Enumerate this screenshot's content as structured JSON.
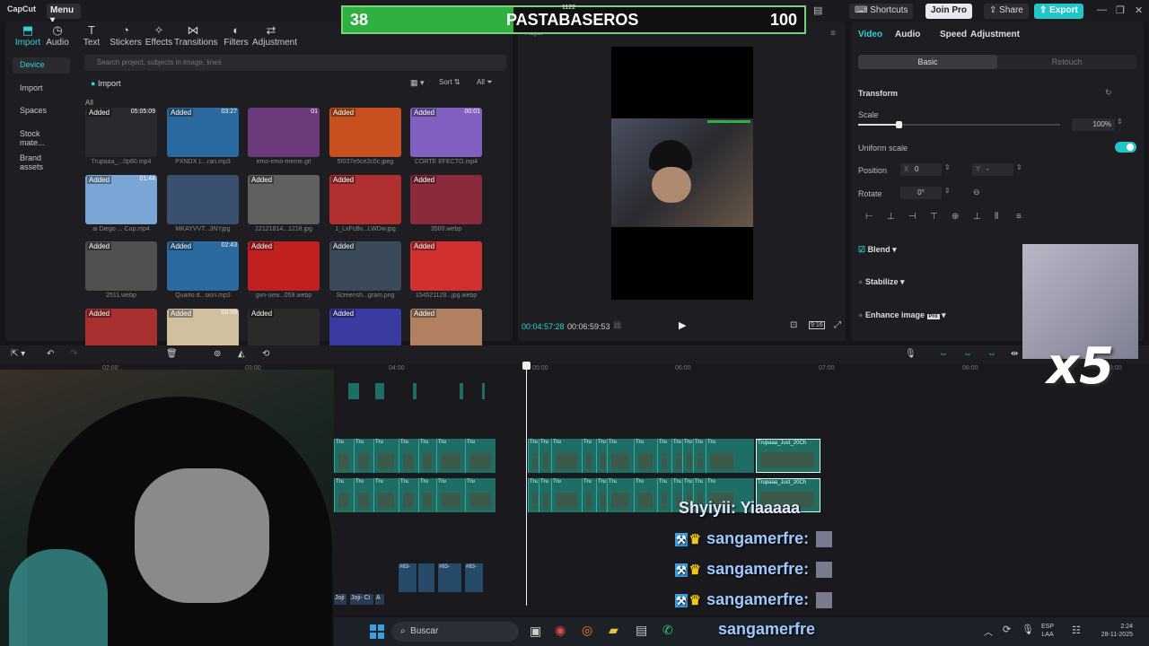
{
  "app": {
    "logo": "CapCut",
    "menu": "Menu",
    "shortcuts": "Shortcuts",
    "join_pro": "Join Pro",
    "share": "Share",
    "export": "Export"
  },
  "toolbar": [
    {
      "label": "Import",
      "icon": "⬒"
    },
    {
      "label": "Audio",
      "icon": "◷"
    },
    {
      "label": "Text",
      "icon": "T"
    },
    {
      "label": "Stickers",
      "icon": "◔"
    },
    {
      "label": "Effects",
      "icon": "✧"
    },
    {
      "label": "Transitions",
      "icon": "⋈"
    },
    {
      "label": "Filters",
      "icon": "◐"
    },
    {
      "label": "Adjustment",
      "icon": "⇄"
    }
  ],
  "sidebar": [
    "Device",
    "Import",
    "Spaces",
    "Stock mate...",
    "Brand assets"
  ],
  "search_placeholder": "Search project, subjects in image, lines",
  "import_label": "Import",
  "sort_label": "Sort",
  "all_label": "All",
  "all_heading": "All",
  "media": [
    {
      "badge": "Added",
      "dur": "05:05:09",
      "name": "Trupaaa_...0p60.mp4",
      "color": "#2a2a2e"
    },
    {
      "badge": "Added",
      "dur": "03:27",
      "name": "PXNDX L...ran.mp3",
      "color": "#2b6aa0"
    },
    {
      "badge": "",
      "dur": "01",
      "name": "emo-emo-meme.gif",
      "color": "#6a3a7a"
    },
    {
      "badge": "Added",
      "dur": "",
      "name": "5f037e5ce2c0c.jpeg",
      "color": "#c85020"
    },
    {
      "badge": "Added",
      "dur": "00:01",
      "name": "CORTE EFECTO.mp4",
      "color": "#8060c0"
    },
    {
      "badge": "Added",
      "dur": "01:44",
      "name": "ai Diego ... Cup.mp4",
      "color": "#7aa6d6"
    },
    {
      "badge": "",
      "dur": "",
      "name": "MKAYVVT...3NYjpg",
      "color": "#3a5070"
    },
    {
      "badge": "Added",
      "dur": "",
      "name": "22121814...1218.jpg",
      "color": "#606060"
    },
    {
      "badge": "Added",
      "dur": "",
      "name": "1_LxFcBv...LWDw.jpg",
      "color": "#b03030"
    },
    {
      "badge": "Added",
      "dur": "",
      "name": "3500.webp",
      "color": "#8a2a3a"
    },
    {
      "badge": "Added",
      "dur": "",
      "name": "2511.webp",
      "color": "#505050"
    },
    {
      "badge": "Added",
      "dur": "02:43",
      "name": "Quarto d...sion.mp3",
      "color": "#2b6aa0"
    },
    {
      "badge": "Added",
      "dur": "",
      "name": "gvn-uew...059.webp",
      "color": "#c02020"
    },
    {
      "badge": "Added",
      "dur": "",
      "name": "Screensh...gram.png",
      "color": "#3a4a5a"
    },
    {
      "badge": "Added",
      "dur": "",
      "name": "154521128...jpg.webp",
      "color": "#d03030"
    },
    {
      "badge": "Added",
      "dur": "",
      "name": "",
      "color": "#a83030"
    },
    {
      "badge": "Added",
      "dur": "00:09",
      "name": "",
      "color": "#d0c0a0"
    },
    {
      "badge": "Added",
      "dur": "",
      "name": "",
      "color": "#2a2a2a"
    },
    {
      "badge": "Added",
      "dur": "",
      "name": "",
      "color": "#3a3aa0"
    },
    {
      "badge": "Added",
      "dur": "",
      "name": "",
      "color": "#b08060"
    }
  ],
  "player": {
    "title": "Player",
    "current": "00:04:57:28",
    "total": "00:06:59:53",
    "ratio": "9:16",
    "top_value": "1122"
  },
  "right": {
    "tabs": [
      "Video",
      "Audio",
      "Speed",
      "Adjustment"
    ],
    "basic": "Basic",
    "retouch": "Retouch",
    "transform": "Transform",
    "scale": "Scale",
    "scale_value": "100%",
    "uniform": "Uniform scale",
    "position": "Position",
    "x_label": "X",
    "x_value": "0",
    "y_label": "Y",
    "y_value": "-",
    "rotate": "Rotate",
    "rotate_value": "0°",
    "blend": "Blend",
    "stabilize": "Stabilize",
    "enhance": "Enhance image",
    "pro_tag": "Pro"
  },
  "ruler": [
    "02:00",
    "03:00",
    "04:00",
    "05:00",
    "06:00",
    "07:00",
    "08:00",
    "09:00"
  ],
  "clip_label": "Trupaaa_Just_20Ch",
  "short_clip": "Tru",
  "audio_clips": [
    "#83-",
    "#83-",
    "#83-"
  ],
  "joji_clips": [
    "Joji",
    "Joji- Ci",
    "A"
  ],
  "overlay": {
    "left": "38",
    "title": "PASTABASEROS",
    "right": "100",
    "progress": 0.37,
    "x5": "x5"
  },
  "chat": [
    {
      "user": "Shyiyii",
      "msg": ": Yiaaaaa"
    },
    {
      "user": "sangamerfre",
      "msg": ":"
    },
    {
      "user": "sangamerfre",
      "msg": ":"
    },
    {
      "user": "sangamerfre",
      "msg": ":"
    }
  ],
  "taskbar": {
    "search": "Buscar",
    "ticker": "sangamerfre",
    "lang": "ESP",
    "lang2": "LAA",
    "time": "2:24",
    "date": "28-11-2025"
  }
}
